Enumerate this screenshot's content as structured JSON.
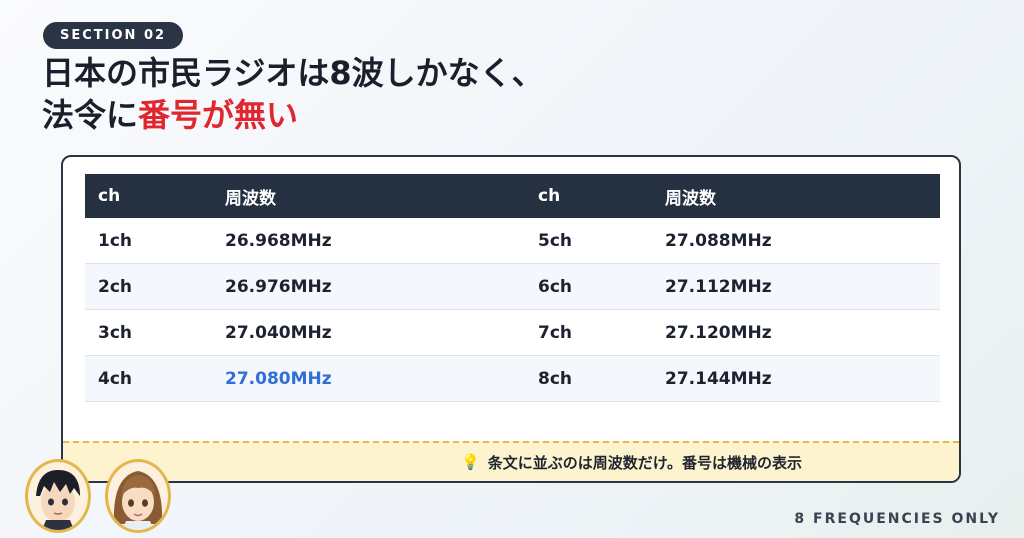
{
  "section_badge": "SECTION 02",
  "title": {
    "line1": "日本の市民ラジオは8波しかなく、",
    "line2_prefix": "法令に",
    "line2_highlight": "番号が無い"
  },
  "table": {
    "headers": [
      "ch",
      "周波数",
      "ch",
      "周波数"
    ],
    "rows": [
      {
        "ch_left": "1ch",
        "freq_left": "26.968MHz",
        "ch_right": "5ch",
        "freq_right": "27.088MHz"
      },
      {
        "ch_left": "2ch",
        "freq_left": "26.976MHz",
        "ch_right": "6ch",
        "freq_right": "27.112MHz"
      },
      {
        "ch_left": "3ch",
        "freq_left": "27.040MHz",
        "ch_right": "7ch",
        "freq_right": "27.120MHz"
      },
      {
        "ch_left": "4ch",
        "freq_left": "27.080MHz",
        "ch_right": "8ch",
        "freq_right": "27.144MHz"
      }
    ]
  },
  "note": {
    "icon": "lightbulb-icon",
    "text": "条文に並ぶのは周波数だけ。番号は機械の表示"
  },
  "footer": "8 FREQUENCIES ONLY",
  "colors": {
    "accent_red": "#e0262e",
    "highlight_blue": "#2f6fd6",
    "header_dark": "#253041",
    "note_bg": "#fdf3cf"
  }
}
